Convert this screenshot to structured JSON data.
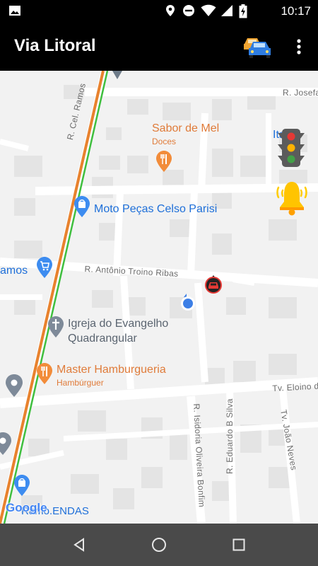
{
  "status_bar": {
    "time": "10:17",
    "icons": [
      "image-icon",
      "location-icon",
      "do-not-disturb-icon",
      "wifi-icon",
      "signal-icon",
      "battery-charging-icon"
    ]
  },
  "app_bar": {
    "title": "Via Litoral",
    "actions": [
      "car-icon",
      "more-vert-icon"
    ]
  },
  "map": {
    "streets": {
      "cel_ramos": "R. Cel. Ramos",
      "josefa": "R. Josefa",
      "antonio": "R. Antônio Troino Ribas",
      "eloino": "Tv. Eloino de",
      "isidoria": "R. Isidoria Oliveira Bonfim",
      "eduardo": "R. Eduardo B Silva",
      "joao": "Tv. João Neves"
    },
    "pois": {
      "sabor_name": "Sabor de Mel",
      "sabor_sub": "Doces",
      "it_prefix": "Ita",
      "moto": "Moto Peças Celso Parisi",
      "ramos": "amos",
      "igreja_line1": "Igreja do Evangelho",
      "igreja_line2": "Quadrangular",
      "master_name": "Master Hamburgueria",
      "master_sub": "Hambúrguer",
      "bottom": "Ramo.ENDAS"
    },
    "google_logo": "Google",
    "overlays": [
      "traffic-light-icon",
      "alert-bell-icon",
      "car-marker-icon",
      "my-location-dot"
    ]
  },
  "nav_bar": {
    "buttons": [
      "back-button",
      "home-button",
      "recents-button"
    ]
  },
  "colors": {
    "bar": "#000000",
    "nav": "#4a4a4a",
    "route_orange": "#e8822e",
    "route_green": "#3fbf3f",
    "poi_blue": "#1e6fd9",
    "poi_orange": "#e07b39",
    "bell_yellow": "#ffcc00"
  }
}
